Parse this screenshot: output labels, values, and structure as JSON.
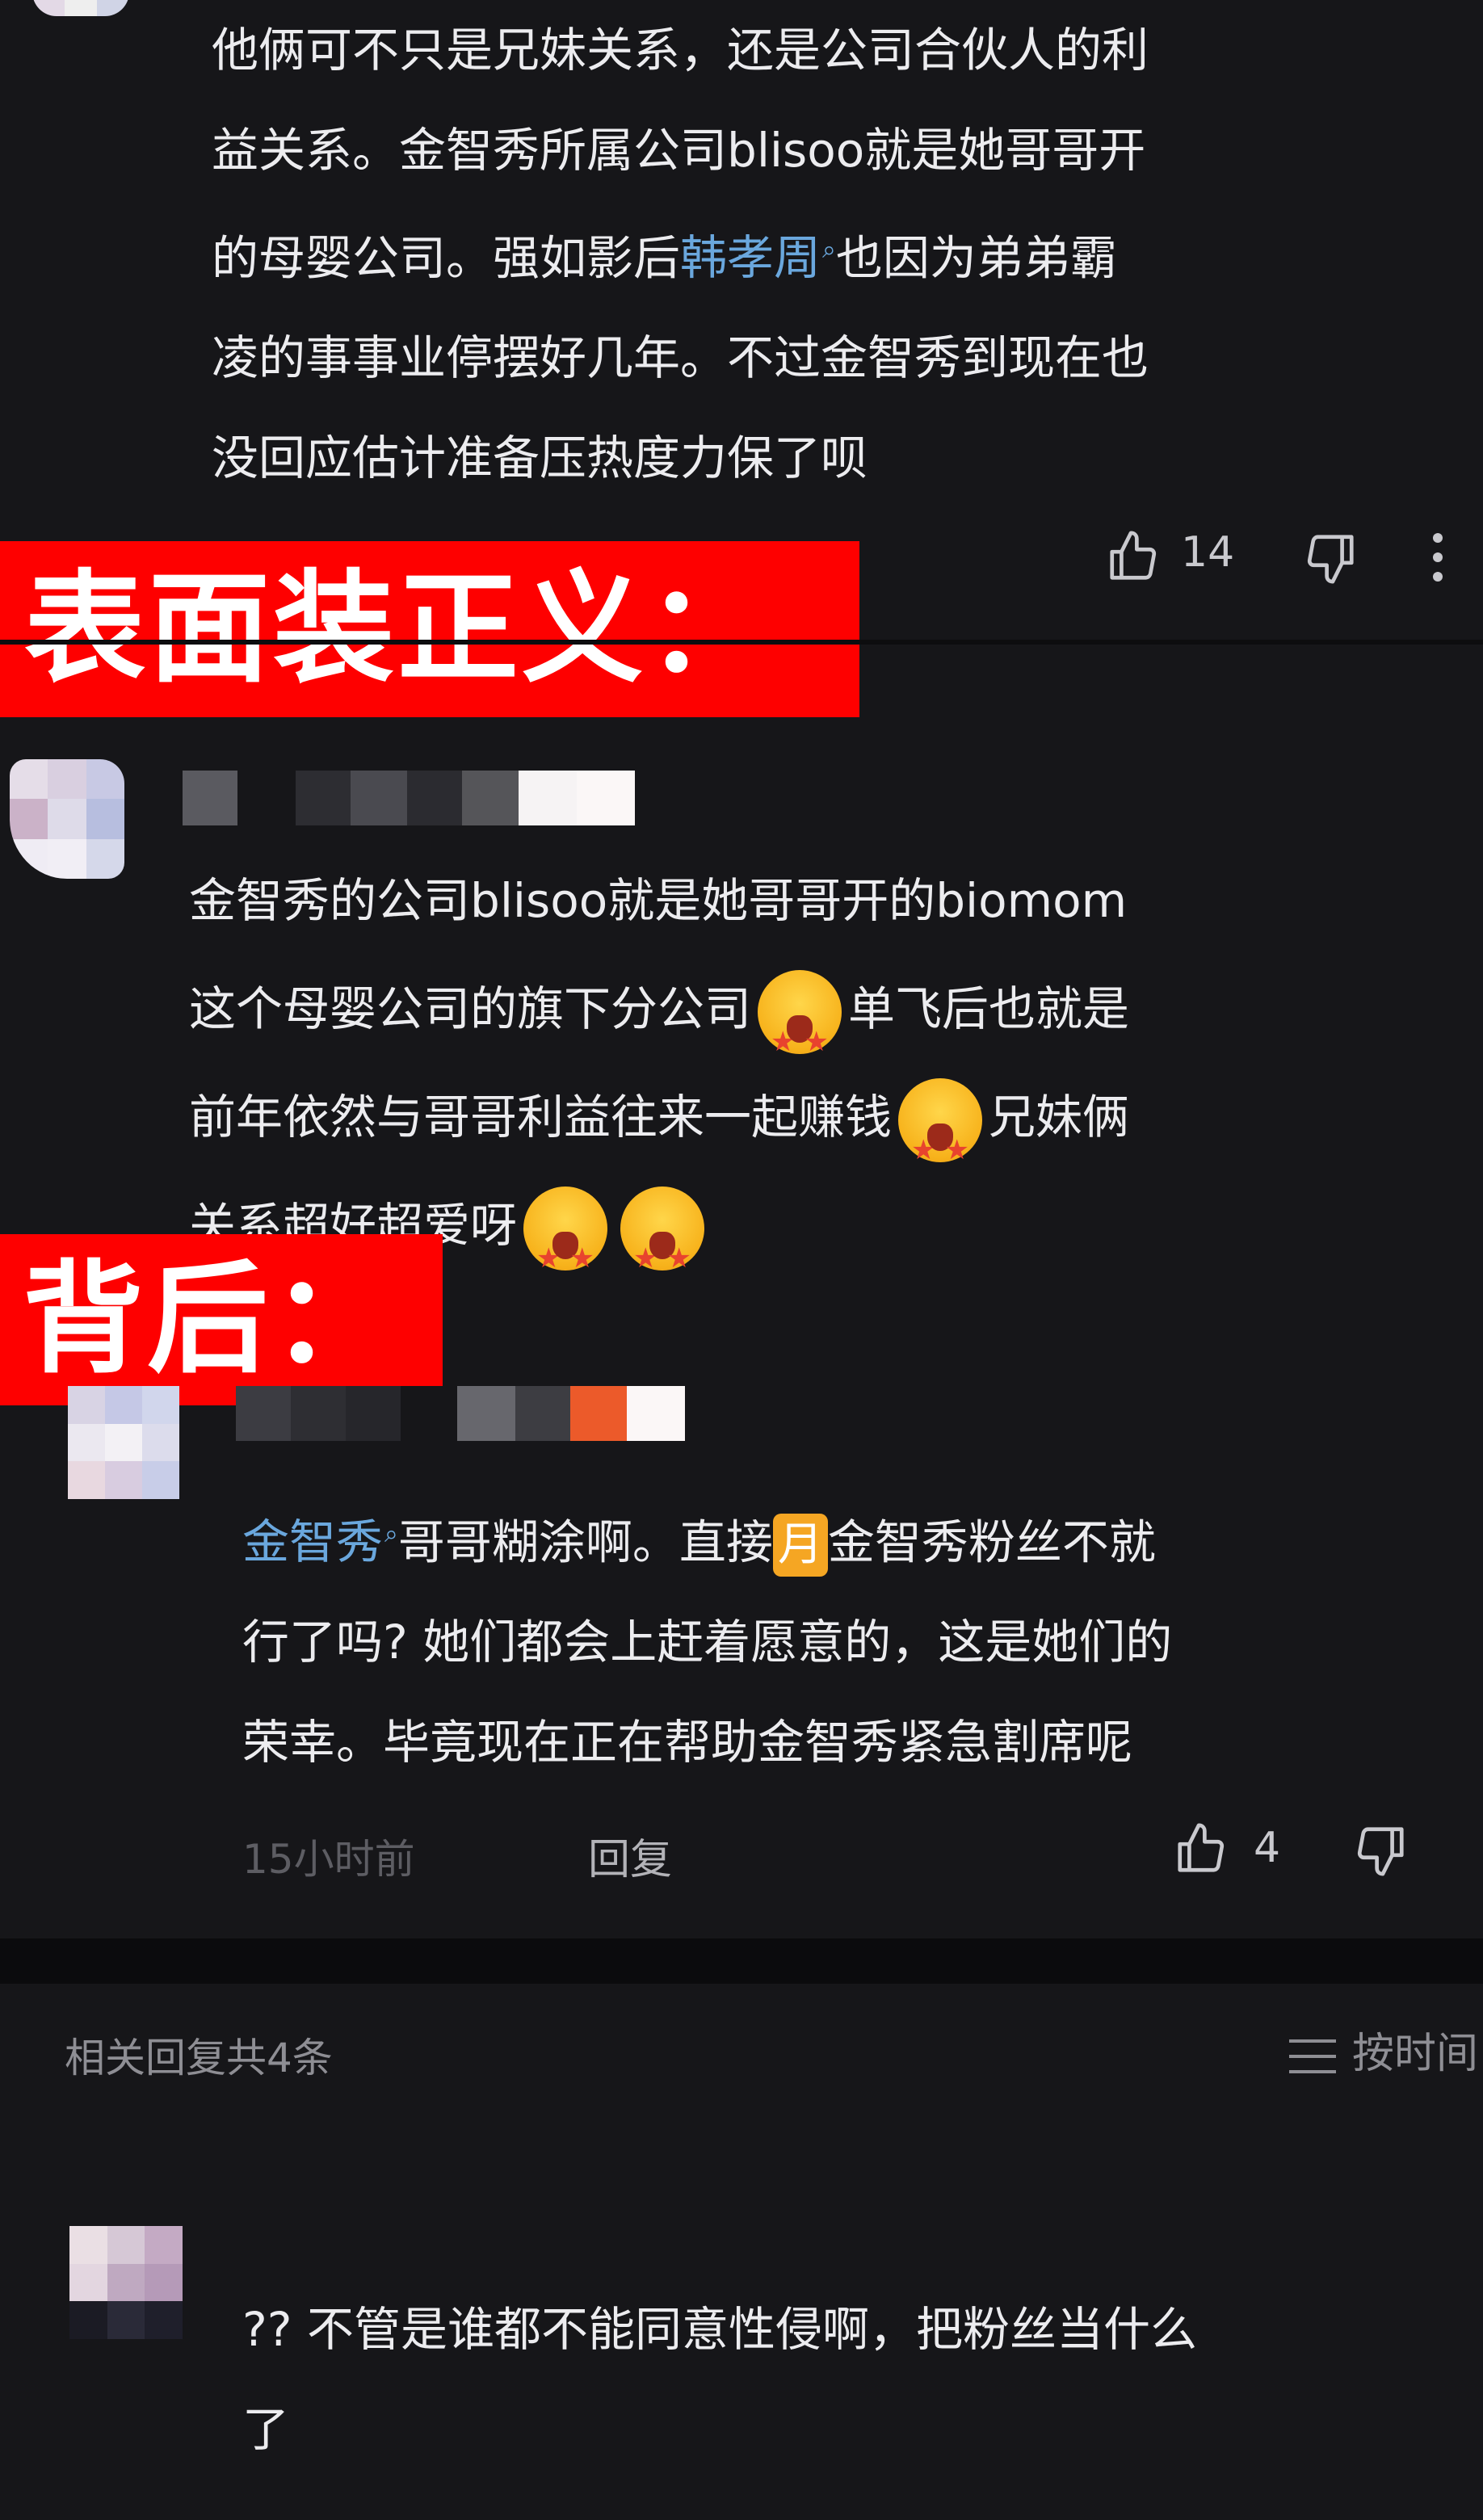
{
  "comment1": {
    "lines": [
      "他俩可不只是兄妹关系，还是公司合伙人的利",
      "益关系。金智秀所属公司blisoo就是她哥哥开",
      "的母婴公司。强如影后",
      "凌的事事业停摆好几年。不过金智秀到现在也",
      "没回应估计准备压热度力保了呗"
    ],
    "link": "韩孝周",
    "line3_tail": "也因为弟弟霸",
    "likes": "14"
  },
  "banner_top": "表面装正义：",
  "comment2": {
    "lines": [
      "金智秀的公司blisoo就是她哥哥开的biomom",
      "这个母婴公司的旗下分公司",
      "单飞后也就是",
      "前年依然与哥哥利益往来一起赚钱",
      "兄妹俩",
      "关系超好超爱呀"
    ]
  },
  "banner_bottom": "背后：",
  "comment3": {
    "link": "金智秀",
    "line1_mid": "哥哥糊涂啊。直接",
    "badge": "月",
    "line1_tail": "金智秀粉丝不就",
    "line2": "行了吗? 她们都会上赶着愿意的，这是她们的",
    "line3": "荣幸。毕竟现在正在帮助金智秀紧急割席呢",
    "time": "15小时前",
    "reply": "回复",
    "likes": "4"
  },
  "related": {
    "count_label": "相关回复共4条",
    "sort_label": "按时间"
  },
  "comment4": {
    "line1": "?? 不管是谁都不能同意性侵啊，把粉丝当什么",
    "line2": "了"
  },
  "icons": [
    "thumbs-up-icon",
    "thumbs-down-icon",
    "more-icon",
    "search-icon",
    "sort-icon"
  ],
  "colors": {
    "background": "#161619",
    "banner": "#fe0000",
    "link": "#6aa7dd",
    "badge": "#f5a623"
  }
}
